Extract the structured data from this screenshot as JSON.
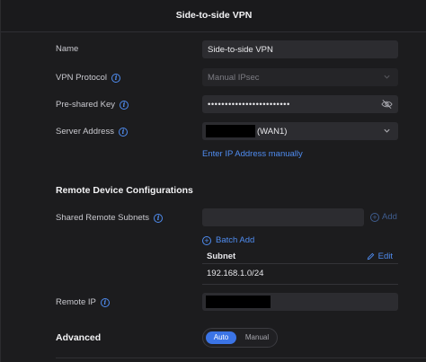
{
  "window": {
    "title": "Side-to-side VPN"
  },
  "fields": {
    "name": {
      "label": "Name",
      "value": "Side-to-side VPN"
    },
    "vpn_protocol": {
      "label": "VPN Protocol",
      "value": "Manual IPsec"
    },
    "preshared_key": {
      "label": "Pre-shared Key",
      "value": "••••••••••••••••••••••••"
    },
    "server_address": {
      "label": "Server Address",
      "value": "(WAN1)"
    },
    "enter_ip_link": "Enter IP Address manually"
  },
  "remote": {
    "section_title": "Remote Device Configurations",
    "shared_subnets_label": "Shared Remote Subnets",
    "add_label": "Add",
    "batch_add_label": "Batch Add",
    "subnet_column": "Subnet",
    "edit_label": "Edit",
    "subnets": [
      "192.168.1.0/24"
    ],
    "remote_ip_label": "Remote IP"
  },
  "advanced": {
    "label": "Advanced",
    "options": [
      "Auto",
      "Manual"
    ],
    "selected": "Auto"
  },
  "colors": {
    "accent": "#4f8cf0",
    "background": "#1c1c1e",
    "field": "#2c2c30"
  }
}
